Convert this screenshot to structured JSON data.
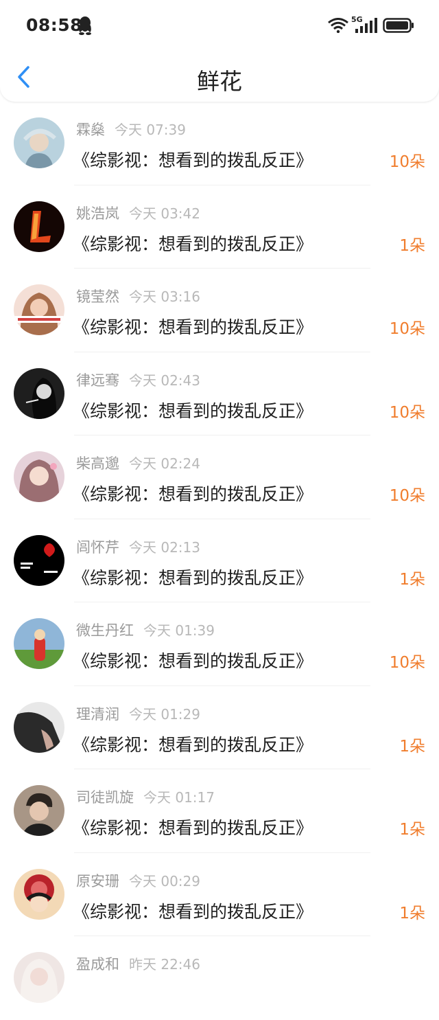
{
  "status_bar": {
    "time": "08:58",
    "network": "5G",
    "icons": [
      "qq-icon",
      "wifi-icon",
      "signal-icon",
      "battery-icon"
    ]
  },
  "header": {
    "title": "鲜花",
    "back_icon": "back-chevron-icon"
  },
  "colors": {
    "accent_blue": "#2f8ff5",
    "count_orange": "#f07d2d"
  },
  "items": [
    {
      "name": "霖燊",
      "time": "今天 07:39",
      "book": "《综影视：想看到的拨乱反正》",
      "count": "10朵",
      "avatar_color": "#9bb8c8"
    },
    {
      "name": "姚浩岚",
      "time": "今天 03:42",
      "book": "《综影视：想看到的拨乱反正》",
      "count": "1朵",
      "avatar_color": "#1a0a05"
    },
    {
      "name": "镜莹然",
      "time": "今天 03:16",
      "book": "《综影视：想看到的拨乱反正》",
      "count": "10朵",
      "avatar_color": "#d9a78e"
    },
    {
      "name": "律远骞",
      "time": "今天 02:43",
      "book": "《综影视：想看到的拨乱反正》",
      "count": "10朵",
      "avatar_color": "#2e2e2e"
    },
    {
      "name": "柴高邈",
      "time": "今天 02:24",
      "book": "《综影视：想看到的拨乱反正》",
      "count": "10朵",
      "avatar_color": "#c6a6b3"
    },
    {
      "name": "闾怀芹",
      "time": "今天 02:13",
      "book": "《综影视：想看到的拨乱反正》",
      "count": "1朵",
      "avatar_color": "#050505"
    },
    {
      "name": "微生丹红",
      "time": "今天 01:39",
      "book": "《综影视：想看到的拨乱反正》",
      "count": "10朵",
      "avatar_color": "#6fa0c8"
    },
    {
      "name": "理清润",
      "time": "今天 01:29",
      "book": "《综影视：想看到的拨乱反正》",
      "count": "1朵",
      "avatar_color": "#3a3a3a"
    },
    {
      "name": "司徒凯旋",
      "time": "今天 01:17",
      "book": "《综影视：想看到的拨乱反正》",
      "count": "1朵",
      "avatar_color": "#8a7868"
    },
    {
      "name": "原安珊",
      "time": "今天 00:29",
      "book": "《综影视：想看到的拨乱反正》",
      "count": "1朵",
      "avatar_color": "#e8c8a8"
    },
    {
      "name": "盈成和",
      "time": "昨天 22:46",
      "book": "",
      "count": "",
      "avatar_color": "#e6d8d4"
    }
  ]
}
